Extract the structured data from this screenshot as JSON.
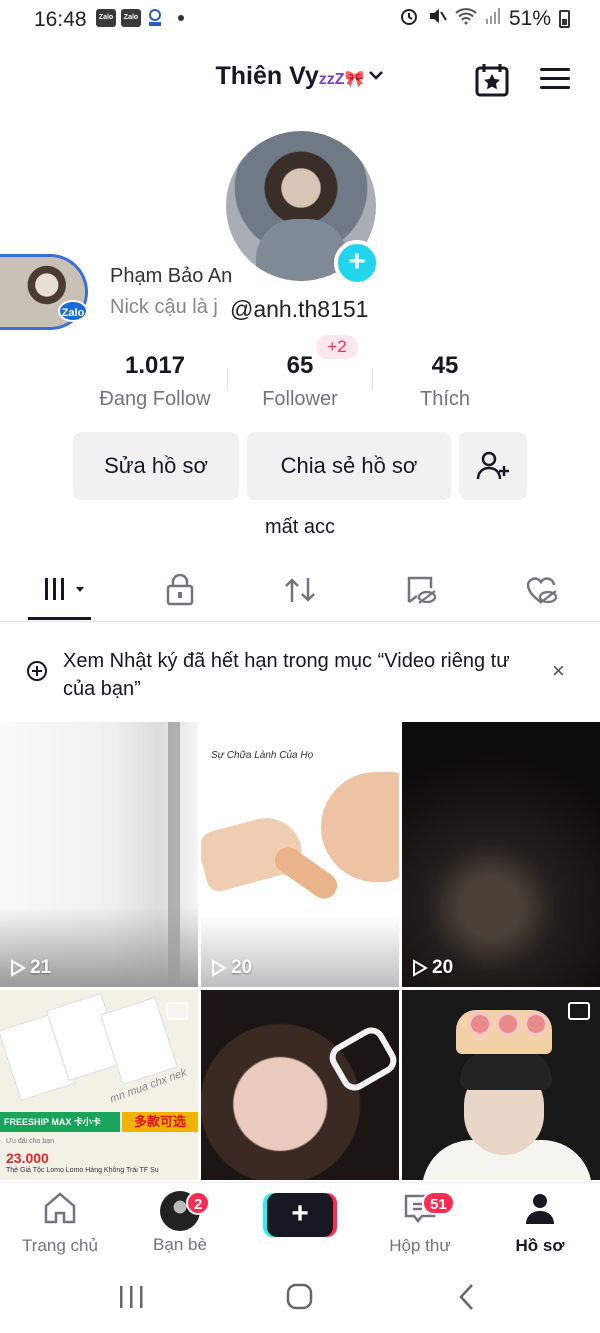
{
  "status_bar": {
    "time": "16:48",
    "apps": [
      "Zalo",
      "Zalo"
    ],
    "battery": "51%"
  },
  "header": {
    "username": "Thiên Vy",
    "username_deco": "zzZ🎀"
  },
  "overlay": {
    "name": "Phạm Bảo An",
    "subtitle": "Nick cậu là j",
    "zalo_tag": "Zalo"
  },
  "profile": {
    "handle": "@anh.th8151",
    "bio": "mất acc",
    "follower_delta": "+2"
  },
  "stats": [
    {
      "value": "1.017",
      "label": "Đang Follow"
    },
    {
      "value": "65",
      "label": "Follower"
    },
    {
      "value": "45",
      "label": "Thích"
    }
  ],
  "actions": {
    "edit": "Sửa hồ sơ",
    "share": "Chia sẻ hồ sơ"
  },
  "banner": {
    "text": "Xem Nhật ký đã hết hạn trong mục “Video riêng tư của bạn”",
    "close": "×"
  },
  "videos": [
    {
      "views": "21"
    },
    {
      "views": "20",
      "caption": "Sự Chữa Lành Của Họ"
    },
    {
      "views": "20"
    }
  ],
  "product_post": {
    "shipping": "FREESHIP MAX 卡小卡",
    "badge": "多款可选",
    "note": "mn mua chx nek",
    "ad_tag": "Ưu đãi cho bạn",
    "price": "23.000",
    "product": "Thẻ Giá Tộc Lomo Lomo Hàng Không Trái TF Su"
  },
  "bottom_nav": [
    {
      "label": "Trang chủ"
    },
    {
      "label": "Bạn bè",
      "badge": "2"
    },
    {
      "label": "Hộp thư",
      "badge": "51"
    },
    {
      "label": "Hồ sơ"
    }
  ],
  "colors": {
    "accent_cyan": "#20d5ec",
    "accent_red": "#fe2c55",
    "text_primary": "#161823",
    "text_secondary": "#73757c"
  }
}
